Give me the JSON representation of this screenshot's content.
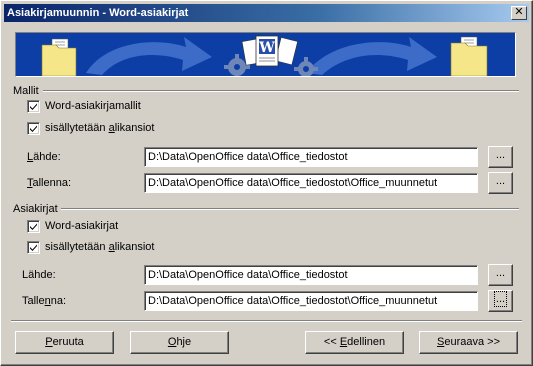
{
  "window": {
    "title": "Asiakirjamuunnin - Word-asiakirjat",
    "close_glyph": "✕"
  },
  "banner": {
    "colors": {
      "background": "#0c3ea6",
      "arrow": "#3c6cc8",
      "folder": "#f6e68a",
      "gear": "#6f86b8"
    },
    "icons": [
      "source-folder-icon",
      "arrow-icon",
      "gears-icon",
      "word-document-icon",
      "target-folder-icon"
    ],
    "word_glyph": "W"
  },
  "templates": {
    "heading": "Mallit",
    "checkbox_word": {
      "label": "Word-asiakirjamallit",
      "checked": true
    },
    "checkbox_subfolders": {
      "label_pre": "sisällytetään ",
      "label_accel": "a",
      "label_post": "likansiot",
      "checked": true
    },
    "source": {
      "label_accel": "L",
      "label_post": "ähde:",
      "value": "D:\\Data\\OpenOffice data\\Office_tiedostot"
    },
    "save": {
      "label_accel": "T",
      "label_post": "allenna:",
      "value": "D:\\Data\\OpenOffice data\\Office_tiedostot\\Office_muunnetut"
    }
  },
  "documents": {
    "heading": "Asiakirjat",
    "checkbox_word": {
      "label": "Word-asiakirjat",
      "checked": true
    },
    "checkbox_subfolders": {
      "label_pre": "sisällytetään ",
      "label_accel": "a",
      "label_post": "likansiot",
      "checked": true
    },
    "source": {
      "label": "Lähde:",
      "value": "D:\\Data\\OpenOffice data\\Office_tiedostot"
    },
    "save": {
      "label_pre": "Talle",
      "label_accel": "n",
      "label_post": "na:",
      "value": "D:\\Data\\OpenOffice data\\Office_tiedostot\\Office_muunnetut"
    }
  },
  "browse_label": "...",
  "buttons": {
    "cancel": {
      "accel": "P",
      "rest": "eruuta"
    },
    "help": {
      "accel": "O",
      "rest": "hje"
    },
    "back": {
      "pre": "<< ",
      "accel": "E",
      "rest": "dellinen"
    },
    "next": {
      "accel": "S",
      "rest": "euraava >>"
    }
  }
}
